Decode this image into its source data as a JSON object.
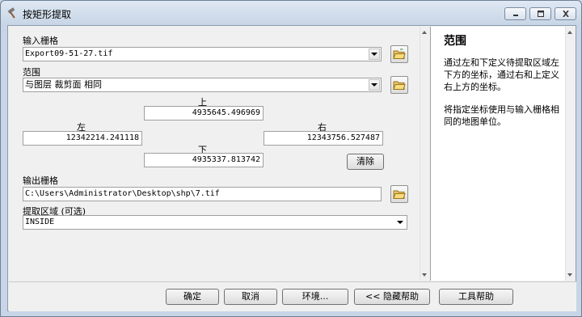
{
  "window": {
    "title": "按矩形提取"
  },
  "form": {
    "input_raster_label": "输入栅格",
    "input_raster_value": "Export09-51-27.tif",
    "extent_label": "范围",
    "extent_value": "与图层 裁剪面 相同",
    "top_label": "上",
    "top_value": "4935645.496969",
    "left_label": "左",
    "left_value": "12342214.241118",
    "right_label": "右",
    "right_value": "12343756.527487",
    "bottom_label": "下",
    "bottom_value": "4935337.813742",
    "clear_button": "清除",
    "output_raster_label": "输出栅格",
    "output_raster_value": "C:\\Users\\Administrator\\Desktop\\shp\\7.tif",
    "extraction_area_label": "提取区域 (可选)",
    "extraction_area_value": "INSIDE"
  },
  "help": {
    "title": "范围",
    "paragraph1": "通过左和下定义待提取区域左下方的坐标，通过右和上定义右上方的坐标。",
    "paragraph2": "将指定坐标使用与输入栅格相同的地图单位。"
  },
  "buttons": {
    "ok": "确定",
    "cancel": "取消",
    "environments": "环境...",
    "hide_help": "<< 隐藏帮助",
    "tool_help": "工具帮助"
  }
}
